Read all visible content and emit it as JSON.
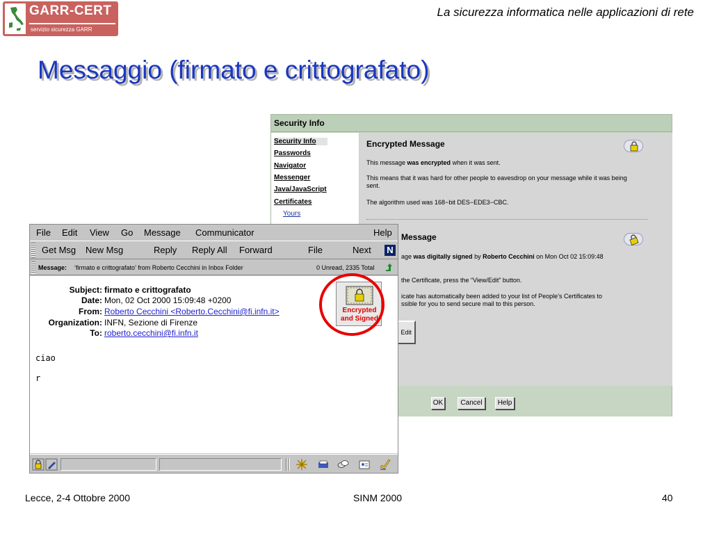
{
  "slide": {
    "logo_brand": "GARR-CERT",
    "logo_sub": "servizio sicurezza GARR",
    "header_title": "La sicurezza informatica nelle applicazioni di rete",
    "title": "Messaggio (firmato e crittografato)",
    "footer_left": "Lecce, 2-4 Ottobre 2000",
    "footer_center": "SINM 2000",
    "footer_right": "40"
  },
  "security_window": {
    "title": "Security Info",
    "nav": [
      {
        "label": "Security Info",
        "active": true
      },
      {
        "label": "Passwords"
      },
      {
        "label": "Navigator"
      },
      {
        "label": "Messenger"
      },
      {
        "label": "Java/JavaScript"
      },
      {
        "label": "Certificates"
      },
      {
        "label": "Yours",
        "sub": true
      }
    ],
    "encrypted": {
      "heading": "Encrypted Message",
      "p1_pre": "This message ",
      "p1_bold": "was encrypted",
      "p1_post": " when it was sent.",
      "p2": "This means that it was hard for other people to eavesdrop on your message while it was being sent.",
      "p3": "The algorithm used was 168−bit DES−EDE3−CBC."
    },
    "signed": {
      "heading_visible": "Message",
      "p1_pre": "age ",
      "p1_bold": "was digitally signed",
      "p1_mid": " by ",
      "p1_name": "Roberto Cecchini",
      "p1_post": " on Mon Oct 02 15:09:48",
      "p2": "the Certificate, press the “View/Edit” button.",
      "p3_line1": "icate has automatically been added to your list of People’s Certificates to",
      "p3_line2": "ssible for you to send secure mail to this person.",
      "edit_button": "Edit"
    },
    "buttons": {
      "ok": "OK",
      "cancel": "Cancel",
      "help": "Help"
    }
  },
  "messenger": {
    "menu": [
      "File",
      "Edit",
      "View",
      "Go",
      "Message",
      "Communicator"
    ],
    "menu_help": "Help",
    "toolbar": {
      "get_msg": "Get Msg",
      "new_msg": "New Msg",
      "reply": "Reply",
      "reply_all": "Reply All",
      "forward": "Forward",
      "file": "File",
      "next": "Next",
      "logo": "N"
    },
    "location": {
      "label": "Message:",
      "text": "‘firmato e crittografato’ from Roberto Cecchini in Inbox Folder",
      "count": "0 Unread, 2335 Total"
    },
    "headers": {
      "subject_label": "Subject:",
      "subject": "firmato e crittografato",
      "date_label": "Date:",
      "date": "Mon, 02 Oct 2000 15:09:48 +0200",
      "from_label": "From:",
      "from": "Roberto Cecchini <Roberto.Cecchini@fi.infn.it>",
      "org_label": "Organization:",
      "org": "INFN, Sezione di Firenze",
      "to_label": "To:",
      "to": "roberto.cecchini@fi.infn.it"
    },
    "security_badge": {
      "line1": "Encrypted",
      "line2": "and Signed"
    },
    "body_lines": [
      "ciao",
      "r"
    ]
  },
  "colors": {
    "title_blue": "#1a37c0",
    "logo_red": "#c9625f",
    "highlight_red": "#e80000",
    "security_green": "#c7d6c3",
    "link_blue": "#2222cc"
  }
}
